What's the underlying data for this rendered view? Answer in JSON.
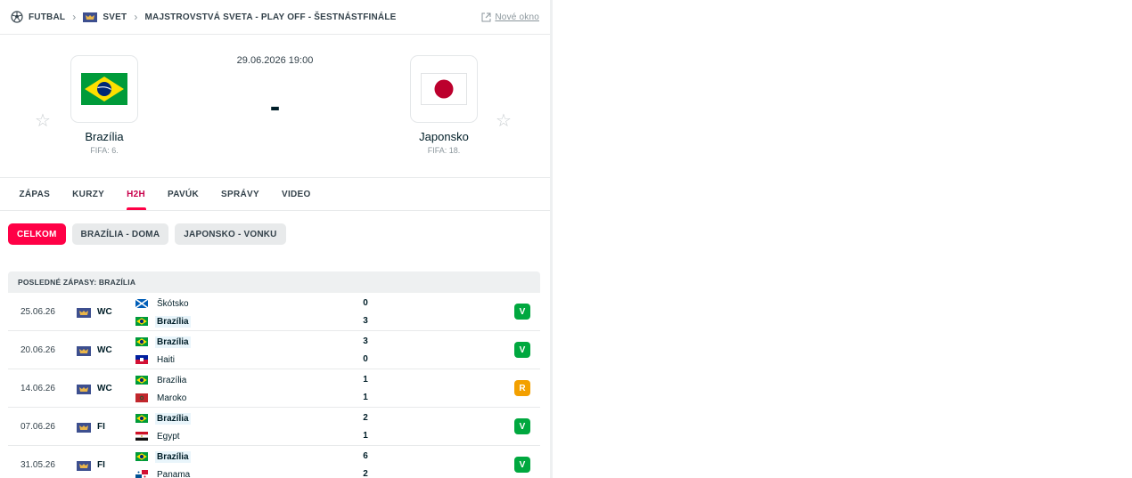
{
  "breadcrumb": {
    "sport": "FUTBAL",
    "region": "SVET",
    "competition": "MAJSTROVSTVÁ SVETA - PLAY OFF - ŠESTNÁSTFINÁLE",
    "new_window": "Nové okno"
  },
  "match": {
    "datetime": "29.06.2026 19:00",
    "score": "-",
    "home": {
      "name": "Brazília",
      "rank": "FIFA: 6."
    },
    "away": {
      "name": "Japonsko",
      "rank": "FIFA: 18."
    }
  },
  "tabs": [
    "ZÁPAS",
    "KURZY",
    "H2H",
    "PAVÚK",
    "SPRÁVY",
    "VIDEO"
  ],
  "active_tab": "H2H",
  "filters": [
    "CELKOM",
    "BRAZÍLIA - DOMA",
    "JAPONSKO - VONKU"
  ],
  "section_title": "POSLEDNÉ ZÁPASY: BRAZÍLIA",
  "rows": [
    {
      "date": "25.06.26",
      "comp": "WC",
      "team1": "Škótsko",
      "flag1": "scotland",
      "team2": "Brazília",
      "flag2": "brazil",
      "score1": "0",
      "score2": "3",
      "hl": 2,
      "result": "V"
    },
    {
      "date": "20.06.26",
      "comp": "WC",
      "team1": "Brazília",
      "flag1": "brazil",
      "team2": "Haiti",
      "flag2": "haiti",
      "score1": "3",
      "score2": "0",
      "hl": 1,
      "result": "V"
    },
    {
      "date": "14.06.26",
      "comp": "WC",
      "team1": "Brazília",
      "flag1": "brazil",
      "team2": "Maroko",
      "flag2": "morocco",
      "score1": "1",
      "score2": "1",
      "hl": 0,
      "result": "R"
    },
    {
      "date": "07.06.26",
      "comp": "FI",
      "team1": "Brazília",
      "flag1": "brazil",
      "team2": "Egypt",
      "flag2": "egypt",
      "score1": "2",
      "score2": "1",
      "hl": 1,
      "result": "V"
    },
    {
      "date": "31.05.26",
      "comp": "FI",
      "team1": "Brazília",
      "flag1": "brazil",
      "team2": "Panama",
      "flag2": "panama",
      "score1": "6",
      "score2": "2",
      "hl": 1,
      "result": "V"
    }
  ],
  "colors": {
    "accent": "#ff0046",
    "win": "#00a83f",
    "draw": "#f3a000"
  }
}
